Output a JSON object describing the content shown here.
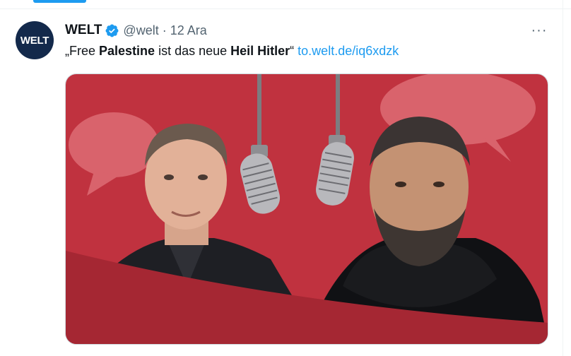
{
  "tweet": {
    "avatar_text": "WELT",
    "display_name": "WELT",
    "handle": "@welt",
    "separator": "·",
    "timestamp": "12 Ara",
    "more_label": "···",
    "text_parts": {
      "p1": "„Free ",
      "p2": "Palestine",
      "p3": " ist das neue ",
      "p4": "Heil Hitler",
      "p5": "“ "
    },
    "link": "to.welt.de/iq6xdzk",
    "icons": {
      "verified": "verified-badge-icon",
      "more": "more-dots-icon"
    }
  },
  "colors": {
    "accent": "#1d9bf0",
    "avatar_bg": "#13294b",
    "card_red": "#c0323f",
    "card_dark_red": "#a52733",
    "bubble": "#d9636c"
  }
}
